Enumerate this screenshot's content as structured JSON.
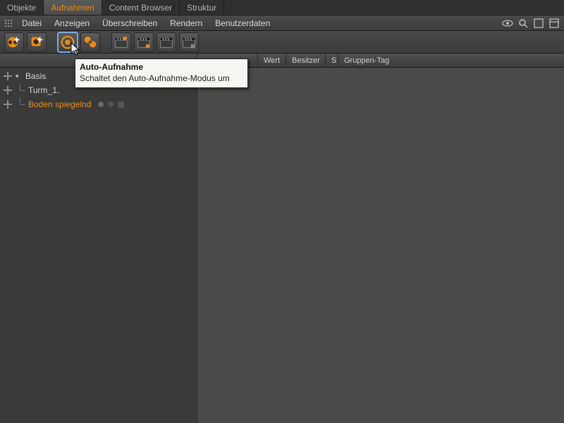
{
  "tabs": {
    "items": [
      "Objekte",
      "Aufnahmen",
      "Content Browser",
      "Struktur"
    ],
    "active": 1
  },
  "menu": {
    "items": [
      "Datei",
      "Anzeigen",
      "Überschreiben",
      "Rendern",
      "Benutzerdaten"
    ]
  },
  "toolbar": {
    "buttons": [
      {
        "name": "record-add-button",
        "icon": "reel-plus"
      },
      {
        "name": "keyframe-add-button",
        "icon": "key-plus"
      },
      {
        "name": "auto-record-button",
        "icon": "auto-circle",
        "active": true
      },
      {
        "name": "hierarchy-auto-button",
        "icon": "orange-nodes"
      },
      {
        "name": "clapper-1-button",
        "icon": "clapper-a"
      },
      {
        "name": "clapper-2-button",
        "icon": "clapper-b"
      },
      {
        "name": "clapper-3-button",
        "icon": "clapper-c"
      },
      {
        "name": "clapper-4-button",
        "icon": "clapper-d"
      }
    ]
  },
  "columns": {
    "wert": "Wert",
    "besitzer": "Besitzer",
    "s": "S",
    "tag": "Gruppen-Tag"
  },
  "tree": {
    "root": {
      "label": "Basis"
    },
    "child1": {
      "label": "Turm_1."
    },
    "child2": {
      "label": "Boden spiegelnd"
    }
  },
  "tooltip": {
    "title": "Auto-Aufnahme",
    "desc": "Schaltet den Auto-Aufnahme-Modus um"
  }
}
